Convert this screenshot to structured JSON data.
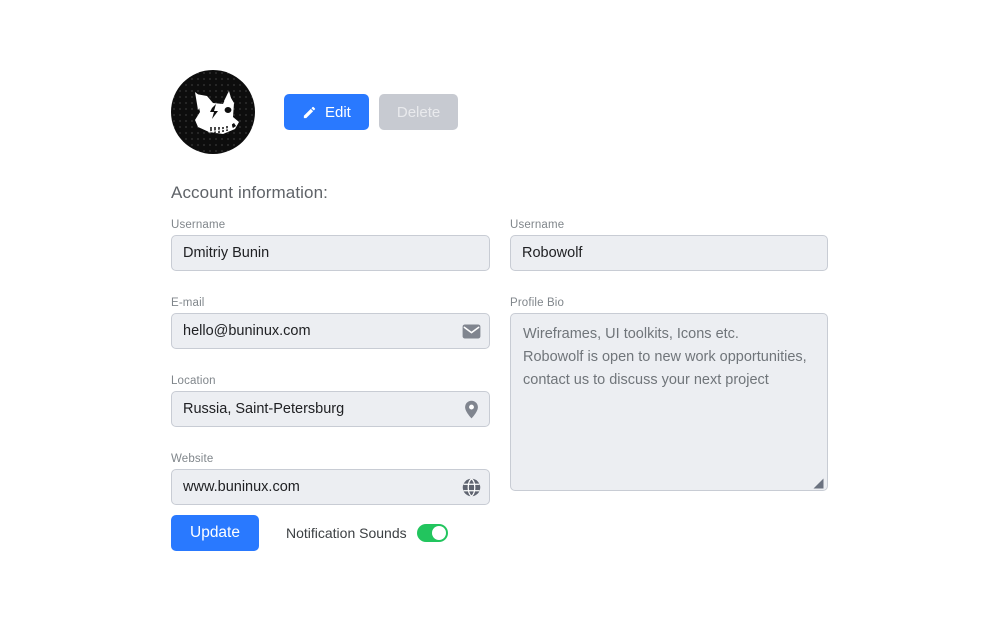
{
  "profile": {
    "avatar_alt": "Robowolf avatar",
    "edit_button": "Edit",
    "delete_button": "Delete"
  },
  "section": {
    "title": "Account information:"
  },
  "left_column": [
    {
      "label": "Username",
      "value": "Dmitriy Bunin",
      "placeholder": "Username",
      "icon": ""
    },
    {
      "label": "E-mail",
      "value": "hello@buninux.com",
      "placeholder": "E-mail",
      "icon": "envelope-icon"
    },
    {
      "label": "Location",
      "value": "Russia, Saint-Petersburg",
      "placeholder": "Location",
      "icon": "map-pin-icon"
    },
    {
      "label": "Website",
      "value": "www.buninux.com",
      "placeholder": "Website",
      "icon": "globe-icon"
    }
  ],
  "right_column": {
    "username": {
      "label": "Username",
      "value": "Robowolf",
      "placeholder": "Username"
    },
    "bio": {
      "label": "Profile Bio",
      "value": "Wireframes, UI toolkits, Icons etc.\nRobowolf is open to new work opportunities,\ncontact us to discuss your next project",
      "placeholder": "Profile Bio"
    }
  },
  "footer": {
    "update_button": "Update",
    "notification_label": "Notification Sounds",
    "notification_enabled": "on"
  },
  "colors": {
    "accent_blue": "#2979ff",
    "toggle_green": "#22c55e",
    "field_bg": "#eceef2",
    "field_border": "#c8ccd4",
    "label_gray": "#80868b",
    "disabled_gray": "#c7cad1"
  }
}
